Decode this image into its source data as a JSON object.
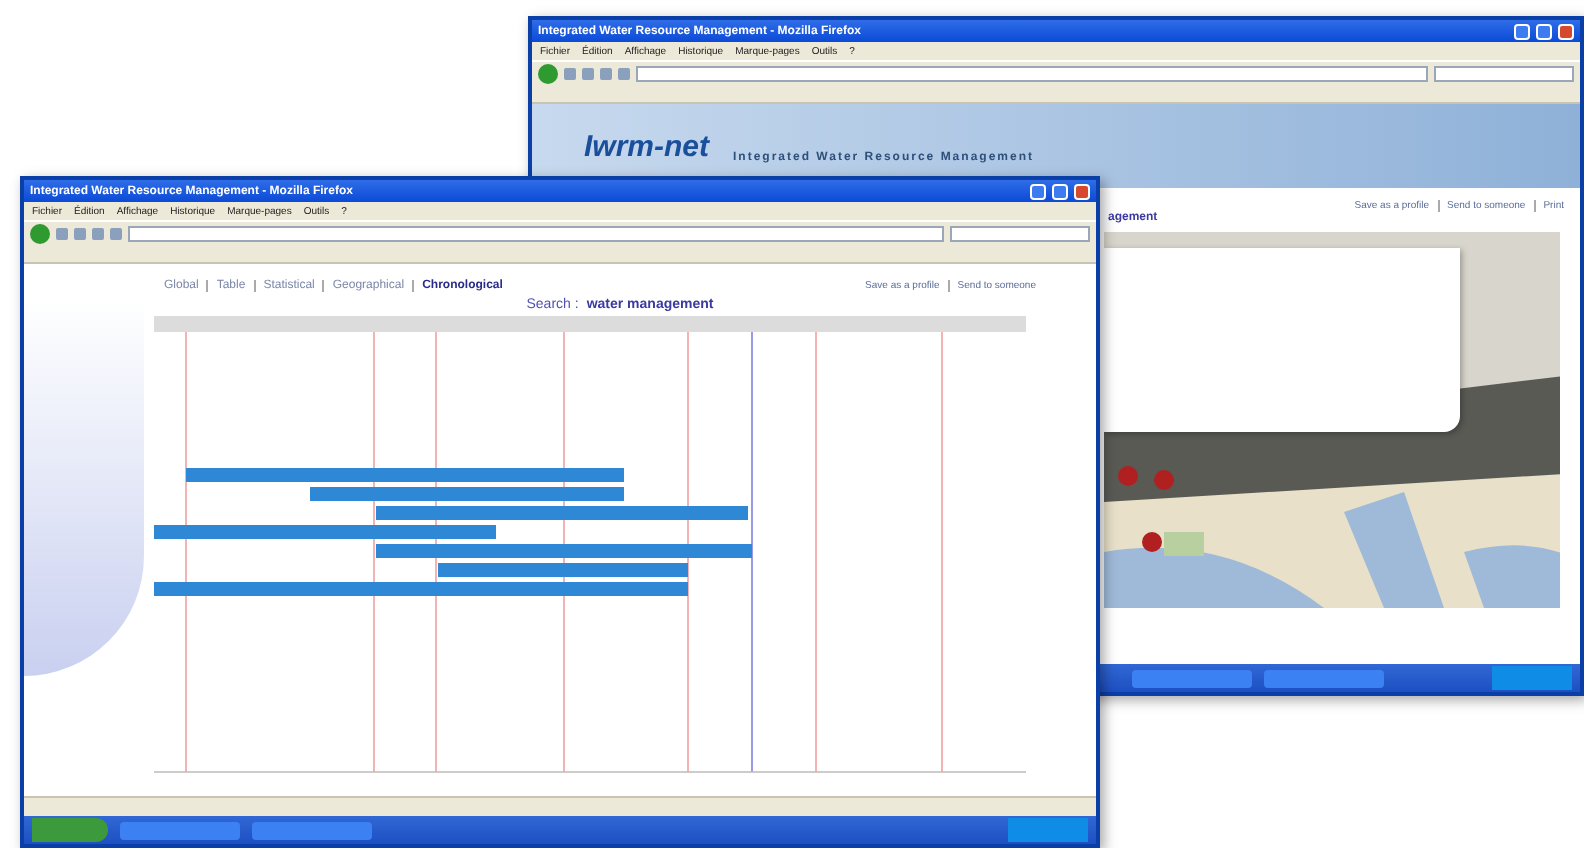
{
  "back_window": {
    "title": "Integrated Water Resource Management - Mozilla Firefox",
    "menu": [
      "Fichier",
      "Édition",
      "Affichage",
      "Historique",
      "Marque-pages",
      "Outils",
      "?"
    ],
    "logo": "Iwrm-net",
    "tagline": "Integrated Water Resource Management",
    "actions": [
      "Save as a profile",
      "Send to someone",
      "Print"
    ],
    "heading_fragment": "agement"
  },
  "front_window": {
    "title": "Integrated Water Resource Management - Mozilla Firefox",
    "menu": [
      "Fichier",
      "Édition",
      "Affichage",
      "Historique",
      "Marque-pages",
      "Outils",
      "?"
    ],
    "views": [
      {
        "label": "Global",
        "selected": false
      },
      {
        "label": "Table",
        "selected": false
      },
      {
        "label": "Statistical",
        "selected": false
      },
      {
        "label": "Geographical",
        "selected": false
      },
      {
        "label": "Chronological",
        "selected": true
      }
    ],
    "actions": [
      "Save as a profile",
      "Send to someone"
    ],
    "search": {
      "label": "Search :",
      "query": "water management"
    }
  }
}
